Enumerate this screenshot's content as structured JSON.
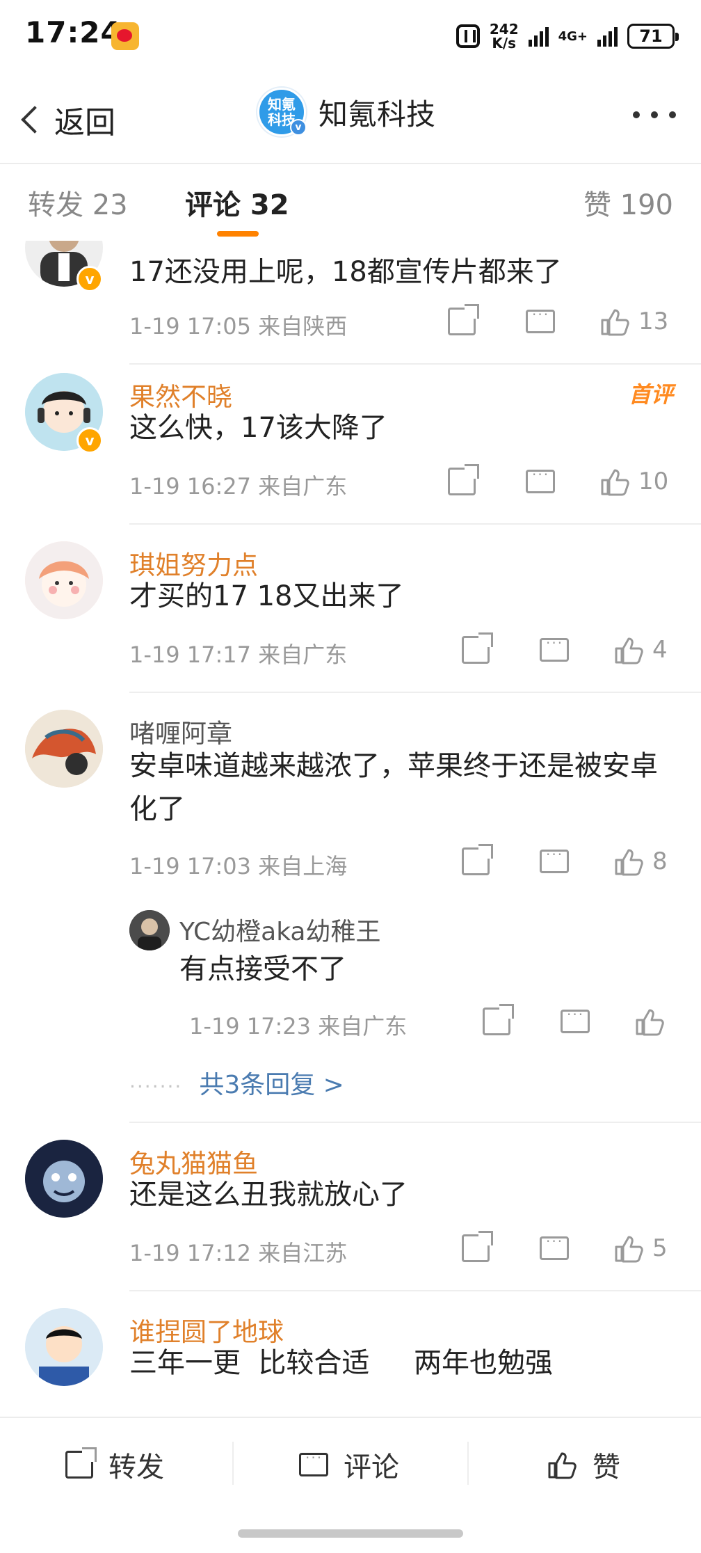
{
  "status_bar": {
    "time": "17:24",
    "speed_value": "242",
    "speed_unit": "K/s",
    "network": "4G+",
    "battery": "71"
  },
  "nav": {
    "back_label": "返回",
    "title": "知氪科技",
    "brand_avatar_text": "知氪科技"
  },
  "tabs": {
    "repost": "转发 23",
    "comment": "评论 32",
    "like": "赞 190"
  },
  "comments": [
    {
      "name": "",
      "text": "17还没用上呢，18都宣传片都来了",
      "meta": "1-19 17:05 来自陕西",
      "likes": "13"
    },
    {
      "name": "果然不晓",
      "badge": "首评",
      "text": "这么快，17该大降了",
      "meta": "1-19 16:27 来自广东",
      "likes": "10"
    },
    {
      "name": "琪姐努力点",
      "text": "才买的17 18又出来了",
      "meta": "1-19 17:17 来自广东",
      "likes": "4"
    },
    {
      "name": "啫喱阿章",
      "text": "安卓味道越来越浓了，苹果终于还是被安卓化了",
      "meta": "1-19 17:03 来自上海",
      "likes": "8",
      "reply": {
        "name": "YC幼橙aka幼稚王",
        "text": "有点接受不了",
        "meta": "1-19 17:23 来自广东"
      },
      "more_replies": "共3条回复 >"
    },
    {
      "name": "兔丸猫猫鱼",
      "text": "还是这么丑我就放心了",
      "meta": "1-19 17:12 来自江苏",
      "likes": "5"
    },
    {
      "name": "谁捏圆了地球",
      "text": "三年一更  比较合适     两年也勉强"
    }
  ],
  "bottom_bar": {
    "repost": "转发",
    "comment": "评论",
    "like": "赞"
  },
  "colors": {
    "accent": "#ff8200",
    "username": "#e0802a",
    "link": "#4a7bb0",
    "meta": "#999999"
  }
}
